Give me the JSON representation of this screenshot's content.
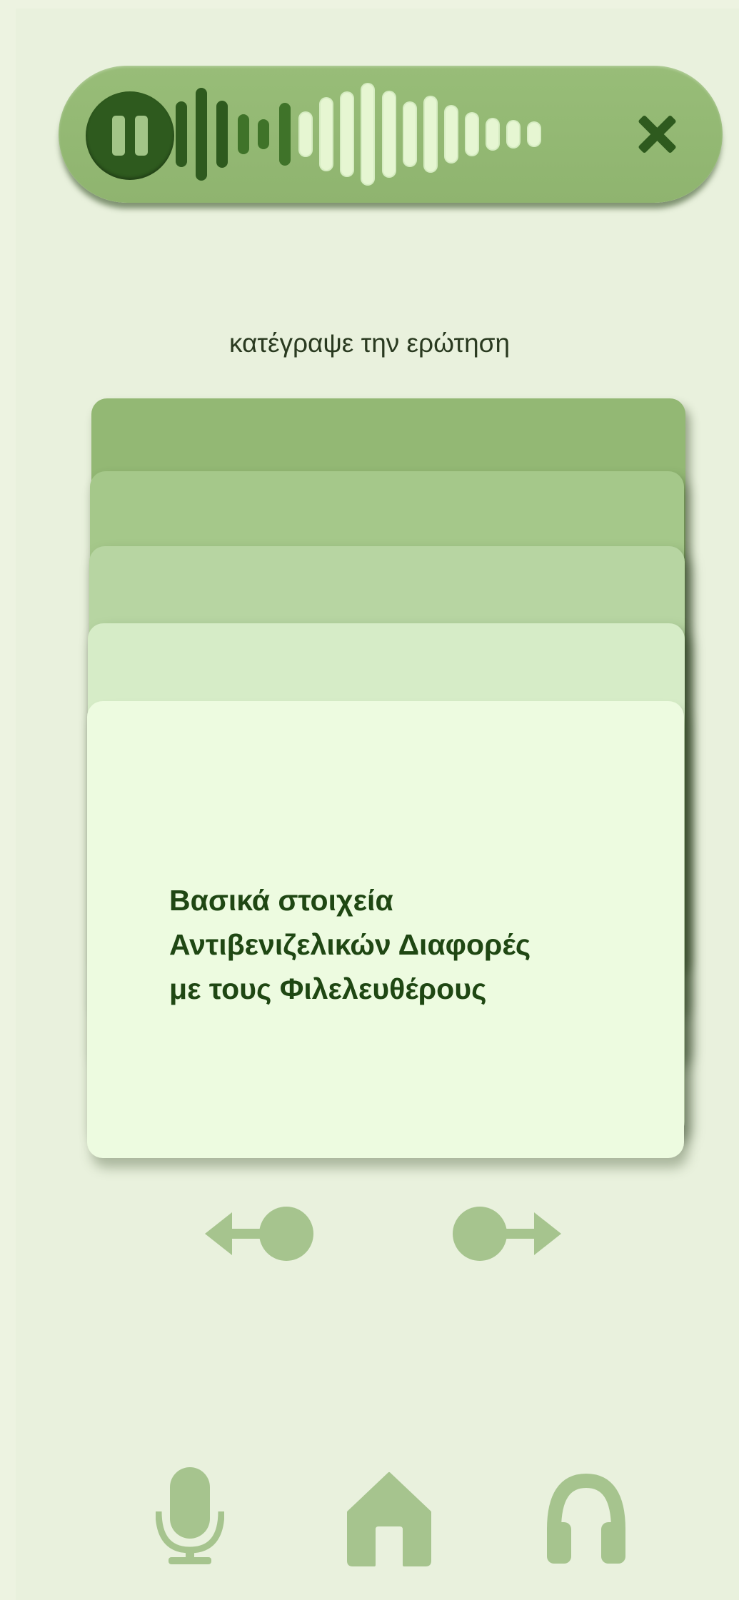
{
  "recording": {
    "pause_icon": "pause-icon",
    "close_icon": "close-icon",
    "waveform_icon": "waveform",
    "colors": {
      "dark": "#2e5a1e",
      "mid": "#3f7329",
      "light": "#e6f6d2"
    }
  },
  "prompt": {
    "text": "κατέγραψε την ερώτηση"
  },
  "card": {
    "lines": [
      "Βασικά στοιχεία",
      "Αντιβενιζελικών Διαφορές",
      "με τους Φιλελευθέρους"
    ]
  },
  "navigation": {
    "prev_icon": "arrow-left-icon",
    "next_icon": "arrow-right-icon"
  },
  "bottom_nav": [
    {
      "icon": "microphone-icon"
    },
    {
      "icon": "home-icon"
    },
    {
      "icon": "headphones-icon"
    }
  ],
  "colors": {
    "background": "#e9f1dd",
    "accent": "#a6c48e",
    "text_dark": "#1f4713"
  }
}
